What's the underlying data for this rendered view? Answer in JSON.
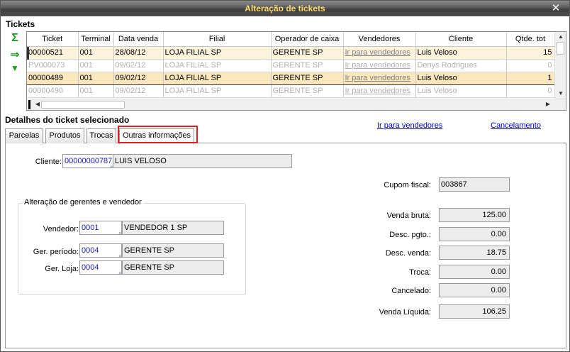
{
  "window": {
    "title": "Alteração de tickets",
    "close_icon": "✕"
  },
  "tickets": {
    "section_title": "Tickets",
    "toolbar": [
      {
        "name": "sum-icon",
        "glyph": "Σ",
        "color": "#1a9a1a"
      },
      {
        "name": "export-icon",
        "glyph": "⇒",
        "color": "#1a9a1a"
      },
      {
        "name": "expand-icon",
        "glyph": "▼",
        "color": "#1a9a1a"
      }
    ],
    "columns": [
      "Ticket",
      "Terminal",
      "Data venda",
      "Filial",
      "Operador de caixa",
      "Vendedores",
      "Cliente",
      "Qtde. tot"
    ],
    "rows": [
      {
        "ticket": "00000521",
        "terminal": "001",
        "data": "28/08/12",
        "filial": "LOJA FILIAL SP",
        "operador": "GERENTE  SP",
        "vendedores": "Ir para vendedores",
        "cliente": "Luis Veloso",
        "qtde": "15",
        "state": "active"
      },
      {
        "ticket": "PV000073",
        "terminal": "001",
        "data": "09/02/12",
        "filial": "LOJA FILIAL SP",
        "operador": "GERENTE  SP",
        "vendedores": "Ir para vendedores",
        "cliente": "Denys Rodrigues",
        "qtde": "0",
        "state": "muted"
      },
      {
        "ticket": "00000489",
        "terminal": "001",
        "data": "09/02/12",
        "filial": "LOJA FILIAL SP",
        "operador": "GERENTE  SP",
        "vendedores": "Ir para vendedores",
        "cliente": "Luis Veloso",
        "qtde": "1",
        "state": "selected"
      },
      {
        "ticket": "00000490",
        "terminal": "001",
        "data": "09/02/12",
        "filial": "LOJA FILIAL SP",
        "operador": "GERENTE  SP",
        "vendedores": "Ir para vendedores",
        "cliente": "Luis Veloso",
        "qtde": "0",
        "state": "muted"
      }
    ]
  },
  "details": {
    "section_title": "Detalhes do ticket selecionado",
    "links": {
      "vendedores": "Ir para vendedores",
      "cancelamento": "Cancelamento"
    },
    "tabs": [
      "Parcelas",
      "Produtos",
      "Trocas",
      "Outras informações"
    ],
    "active_tab": "Outras informações",
    "cliente": {
      "label": "Cliente:",
      "code": "00000000787",
      "name": "LUIS VELOSO"
    },
    "group": {
      "title": "Alteração de gerentes e vendedor",
      "vendedor": {
        "label": "Vendedor:",
        "code": "0001",
        "name": "VENDEDOR 1 SP"
      },
      "ger_periodo": {
        "label": "Ger. período:",
        "code": "0004",
        "name": "GERENTE  SP"
      },
      "ger_loja": {
        "label": "Ger. Loja:",
        "code": "0004",
        "name": "GERENTE  SP"
      }
    },
    "cupom_fiscal": {
      "label": "Cupom fiscal:",
      "value": "003867"
    },
    "totals": [
      {
        "key": "venda-bruta",
        "label": "Venda bruta:",
        "value": "125.00"
      },
      {
        "key": "desc-pgto",
        "label": "Desc. pgto.:",
        "value": "0.00"
      },
      {
        "key": "desc-venda",
        "label": "Desc. venda:",
        "value": "18.75"
      },
      {
        "key": "troca",
        "label": "Troca:",
        "value": "0.00"
      },
      {
        "key": "cancelado",
        "label": "Cancelado:",
        "value": "0.00"
      },
      {
        "key": "venda-liquida",
        "label": "Venda Líquida:",
        "value": "106.25"
      }
    ]
  }
}
